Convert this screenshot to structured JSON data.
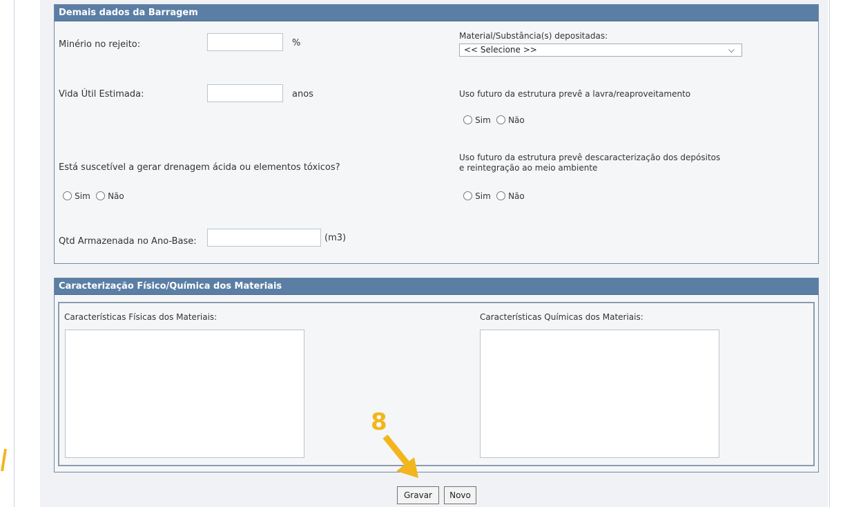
{
  "section1": {
    "title": "Demais dados da Barragem",
    "minerio_label": "Minério no rejeito:",
    "minerio_unit": "%",
    "vida_label": "Vida Útil Estimada:",
    "vida_unit": "anos",
    "drenagem_label": "Está suscetível a gerar drenagem ácida ou elementos tóxicos?",
    "qtd_label": "Qtd Armazenada no Ano-Base:",
    "qtd_unit": "(m3)",
    "material_label": "Material/Substância(s) depositadas:",
    "material_selected": "<< Selecione >>",
    "uso_lavra_label": "Uso futuro da estrutura prevê a lavra/reaproveitamento",
    "uso_desc_label_line1": "Uso futuro da estrutura prevê descaracterização dos depósitos",
    "uso_desc_label_line2": "e reintegração ao meio ambiente",
    "radio_sim": "Sim",
    "radio_nao": "Não"
  },
  "section2": {
    "title": "Caracterização Físico/Química dos Materiais",
    "fisicas_label": "Características Físicas dos Materiais:",
    "quimicas_label": "Características Químicas dos Materiais:"
  },
  "buttons": {
    "gravar": "Gravar",
    "novo": "Novo"
  },
  "annotation": {
    "step_number": "8",
    "color": "#f2b61c"
  }
}
